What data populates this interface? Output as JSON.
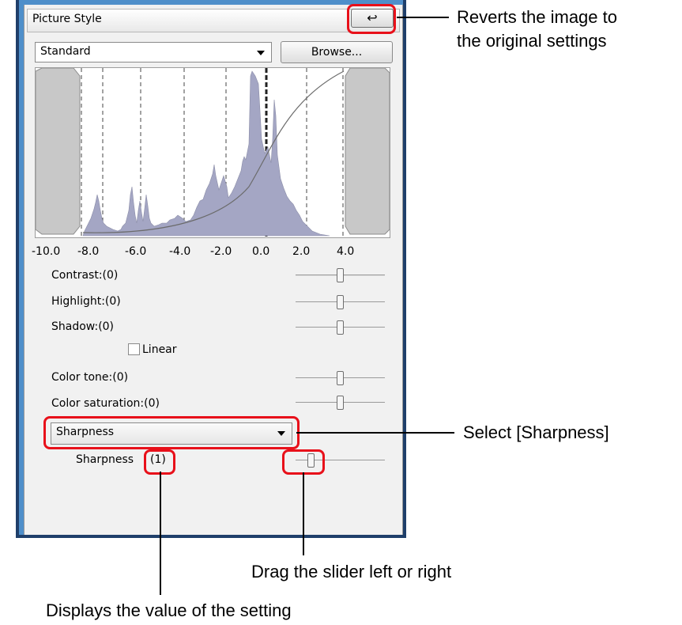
{
  "panel": {
    "title": "Picture Style",
    "revert_icon": "↩",
    "style_select": {
      "selected": "Standard"
    },
    "browse_label": "Browse...",
    "histogram": {
      "x_ticks": [
        "-10.0",
        "-8.0",
        "-6.0",
        "-4.0",
        "-2.0",
        "0.0",
        "2.0",
        "4.0"
      ]
    },
    "sliders": [
      {
        "label": "Contrast:(0)",
        "value": 0
      },
      {
        "label": "Highlight:(0)",
        "value": 0
      },
      {
        "label": "Shadow:(0)",
        "value": 0
      },
      {
        "label": "Color tone:(0)",
        "value": 0
      },
      {
        "label": "Color saturation:(0)",
        "value": 0
      }
    ],
    "linear_label": "Linear",
    "linear_checked": false,
    "detail_select": {
      "selected": "Sharpness"
    },
    "sharpness": {
      "label": "Sharpness",
      "value_text": "(1)",
      "value": 1
    }
  },
  "callouts": {
    "revert": [
      "Reverts the image to",
      "the original settings"
    ],
    "select": "Select [Sharpness]",
    "drag": "Drag the slider left or right",
    "display": "Displays the value of the setting"
  },
  "colors": {
    "frame": "#4f8fca",
    "highlight": "#e8101a",
    "histogram_fill": "#a4a6c4"
  }
}
